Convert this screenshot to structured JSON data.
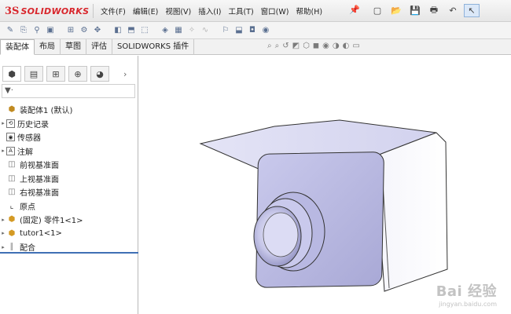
{
  "app": {
    "logo_mark": "3S",
    "logo_text": "SOLIDWORKS"
  },
  "menu": [
    "文件(F)",
    "编辑(E)",
    "视图(V)",
    "插入(I)",
    "工具(T)",
    "窗口(W)",
    "帮助(H)"
  ],
  "quick_access": [
    {
      "icon": "new-document-icon",
      "glyph": "▢"
    },
    {
      "icon": "open-folder-icon",
      "glyph": "📂"
    },
    {
      "icon": "save-icon",
      "glyph": "💾"
    },
    {
      "icon": "print-icon",
      "glyph": "🖶"
    },
    {
      "icon": "undo-icon",
      "glyph": "↶"
    },
    {
      "icon": "select-pointer-icon",
      "glyph": "↖"
    }
  ],
  "tabs": [
    "装配体",
    "布局",
    "草图",
    "评估",
    "SOLIDWORKS 插件"
  ],
  "active_tab": 0,
  "panel_tabs": [
    {
      "icon": "feature-manager-icon",
      "glyph": "⬢"
    },
    {
      "icon": "property-manager-icon",
      "glyph": "▤"
    },
    {
      "icon": "configuration-manager-icon",
      "glyph": "⊞"
    },
    {
      "icon": "dimxpert-icon",
      "glyph": "⊕"
    },
    {
      "icon": "display-manager-icon",
      "glyph": "◕"
    }
  ],
  "filter_label": "▼·",
  "tree": [
    {
      "label": "装配体1  (默认)",
      "icon": "assembly-icon",
      "glyph": "⬢",
      "arrow": "",
      "cls": "ico-asm"
    },
    {
      "label": "历史记录",
      "icon": "history-icon",
      "glyph": "⟲",
      "arrow": "▸",
      "cls": "ico-hist"
    },
    {
      "label": "传感器",
      "icon": "sensor-icon",
      "glyph": "◉",
      "arrow": "",
      "cls": "ico-hist"
    },
    {
      "label": "注解",
      "icon": "annotation-icon",
      "glyph": "A",
      "arrow": "▸",
      "cls": "ico-hist"
    },
    {
      "label": "前视基准面",
      "icon": "plane-icon",
      "glyph": "◫",
      "arrow": "",
      "cls": "ico-plane"
    },
    {
      "label": "上视基准面",
      "icon": "plane-icon",
      "glyph": "◫",
      "arrow": "",
      "cls": "ico-plane"
    },
    {
      "label": "右视基准面",
      "icon": "plane-icon",
      "glyph": "◫",
      "arrow": "",
      "cls": "ico-plane"
    },
    {
      "label": "原点",
      "icon": "origin-icon",
      "glyph": "⌞",
      "arrow": "",
      "cls": "ico-origin"
    },
    {
      "label": "(固定)  零件1<1>",
      "icon": "part-icon",
      "glyph": "⬢",
      "arrow": "▸",
      "cls": "ico-part"
    },
    {
      "label": "tutor1<1>",
      "icon": "part-icon",
      "glyph": "⬢",
      "arrow": "▸",
      "cls": "ico-part"
    },
    {
      "label": "配合",
      "icon": "mates-icon",
      "glyph": "∥",
      "arrow": "▸",
      "cls": "ico-mate"
    }
  ],
  "watermark": {
    "main": "Bai 经验",
    "sub": "jingyan.baidu.com"
  }
}
